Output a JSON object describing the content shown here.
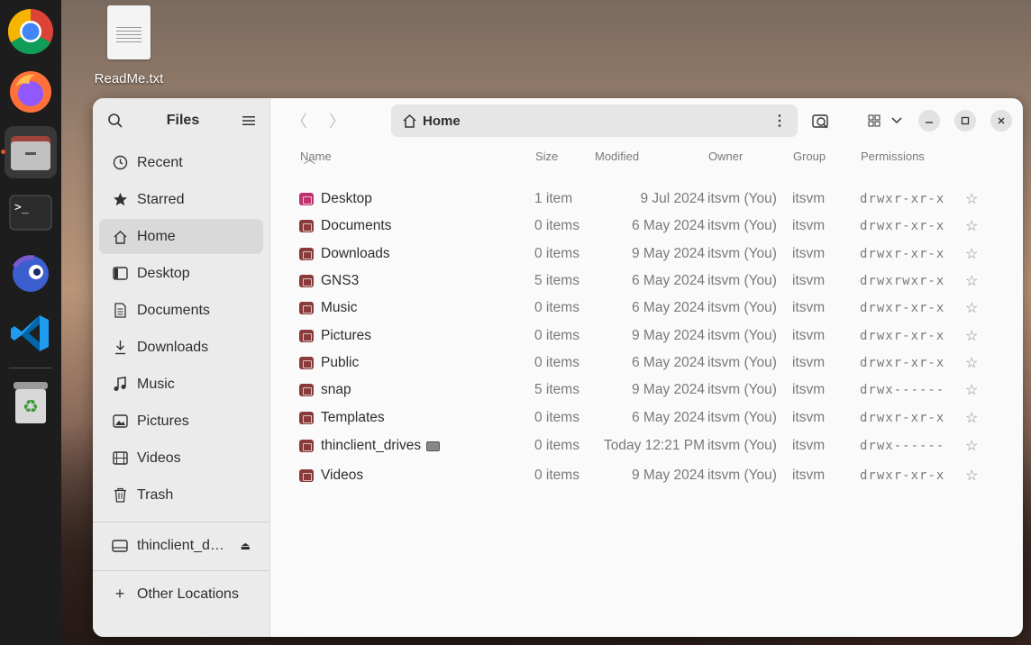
{
  "desktop": {
    "file_label": "ReadMe.txt"
  },
  "dock": {
    "apps": [
      "chrome-icon",
      "firefox-icon",
      "files-icon",
      "terminal-icon",
      "eclipse-icon",
      "vscode-icon"
    ],
    "trash": "trash-icon"
  },
  "window": {
    "sidebar": {
      "title": "Files",
      "items": [
        {
          "label": "Recent",
          "icon": "clock-icon"
        },
        {
          "label": "Starred",
          "icon": "star-icon"
        },
        {
          "label": "Home",
          "icon": "home-icon"
        },
        {
          "label": "Desktop",
          "icon": "desktop-icon"
        },
        {
          "label": "Documents",
          "icon": "document-icon"
        },
        {
          "label": "Downloads",
          "icon": "download-icon"
        },
        {
          "label": "Music",
          "icon": "music-icon"
        },
        {
          "label": "Pictures",
          "icon": "pictures-icon"
        },
        {
          "label": "Videos",
          "icon": "film-icon"
        },
        {
          "label": "Trash",
          "icon": "trash-icon"
        }
      ],
      "drive": {
        "label": "thinclient_d…",
        "icon": "drive-icon"
      },
      "other_locations": "Other Locations",
      "other_icon": "plus-icon"
    },
    "path": {
      "current": "Home"
    },
    "columns": {
      "name": "Name",
      "size": "Size",
      "modified": "Modified",
      "owner": "Owner",
      "group": "Group",
      "permissions": "Permissions"
    },
    "rows": [
      {
        "name": "Desktop",
        "size": "1 item",
        "modified": "9 Jul 2024",
        "owner": "itsvm (You)",
        "group": "itsvm",
        "perm": "drwxr-xr-x",
        "color": "#c0326e"
      },
      {
        "name": "Documents",
        "size": "0 items",
        "modified": "6 May 2024",
        "owner": "itsvm (You)",
        "group": "itsvm",
        "perm": "drwxr-xr-x",
        "color": "#8a3a3a"
      },
      {
        "name": "Downloads",
        "size": "0 items",
        "modified": "9 May 2024",
        "owner": "itsvm (You)",
        "group": "itsvm",
        "perm": "drwxr-xr-x",
        "color": "#8a3a3a"
      },
      {
        "name": "GNS3",
        "size": "5 items",
        "modified": "6 May 2024",
        "owner": "itsvm (You)",
        "group": "itsvm",
        "perm": "drwxrwxr-x",
        "color": "#8a3a3a"
      },
      {
        "name": "Music",
        "size": "0 items",
        "modified": "6 May 2024",
        "owner": "itsvm (You)",
        "group": "itsvm",
        "perm": "drwxr-xr-x",
        "color": "#8a3a3a"
      },
      {
        "name": "Pictures",
        "size": "0 items",
        "modified": "9 May 2024",
        "owner": "itsvm (You)",
        "group": "itsvm",
        "perm": "drwxr-xr-x",
        "color": "#8a3a3a"
      },
      {
        "name": "Public",
        "size": "0 items",
        "modified": "6 May 2024",
        "owner": "itsvm (You)",
        "group": "itsvm",
        "perm": "drwxr-xr-x",
        "color": "#8a3a3a"
      },
      {
        "name": "snap",
        "size": "5 items",
        "modified": "9 May 2024",
        "owner": "itsvm (You)",
        "group": "itsvm",
        "perm": "drwx------",
        "color": "#8a3a3a"
      },
      {
        "name": "Templates",
        "size": "0 items",
        "modified": "6 May 2024",
        "owner": "itsvm (You)",
        "group": "itsvm",
        "perm": "drwxr-xr-x",
        "color": "#8a3a3a"
      },
      {
        "name": "thinclient_drives",
        "size": "0 items",
        "modified": "Today 12:21 PM",
        "owner": "itsvm (You)",
        "group": "itsvm",
        "perm": "drwx------",
        "color": "#8a3a3a"
      },
      {
        "name": "Videos",
        "size": "0 items",
        "modified": "9 May 2024",
        "owner": "itsvm (You)",
        "group": "itsvm",
        "perm": "drwxr-xr-x",
        "color": "#8a3a3a"
      }
    ]
  }
}
